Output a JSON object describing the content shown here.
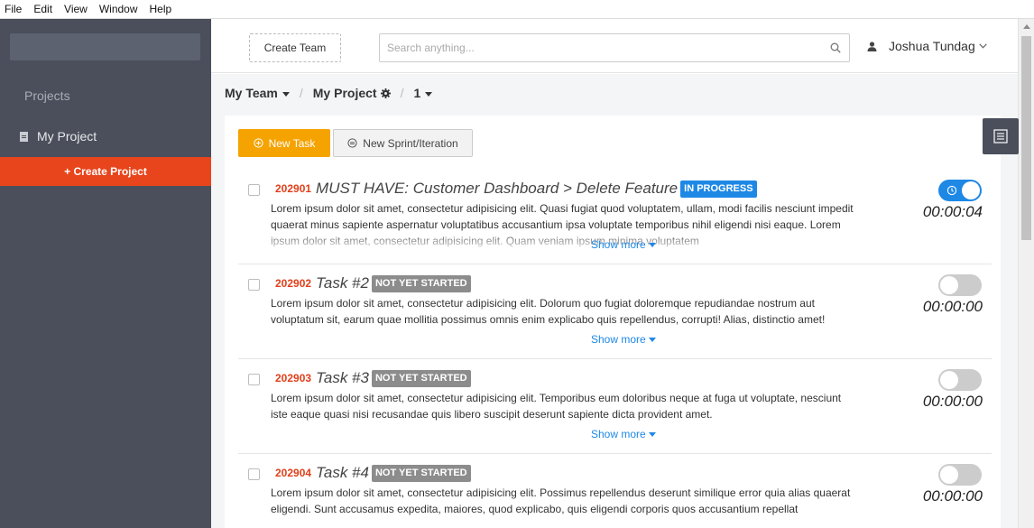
{
  "menu": [
    "File",
    "Edit",
    "View",
    "Window",
    "Help"
  ],
  "sidebar": {
    "section_label": "Projects",
    "project": "My Project",
    "create_project": "+ Create Project"
  },
  "topbar": {
    "create_team": "Create Team",
    "search_placeholder": "Search anything...",
    "user_name": "Joshua Tundag"
  },
  "breadcrumb": {
    "team": "My Team",
    "project": "My Project",
    "sprint": "1"
  },
  "actions": {
    "new_task": "New Task",
    "new_sprint": "New Sprint/Iteration"
  },
  "show_more": "Show more",
  "tasks": [
    {
      "id": "202901",
      "name": "MUST HAVE: Customer Dashboard > Delete Feature",
      "status": "IN PROGRESS",
      "desc": "Lorem ipsum dolor sit amet, consectetur adipisicing elit. Quasi fugiat quod voluptatem, ullam, modi facilis nesciunt impedit quaerat minus sapiente aspernatur voluptatibus accusantium ipsa voluptate temporibus nihil eligendi nisi eaque. Lorem ipsum dolor sit amet, consectetur adipisicing elit. Quam veniam ipsum minima voluptatem",
      "timer": "00:00:04",
      "running": true
    },
    {
      "id": "202902",
      "name": "Task #2",
      "status": "NOT YET STARTED",
      "desc": "Lorem ipsum dolor sit amet, consectetur adipisicing elit. Dolorum quo fugiat doloremque repudiandae nostrum aut voluptatum sit, earum quae mollitia possimus omnis enim explicabo quis repellendus, corrupti! Alias, distinctio amet!",
      "timer": "00:00:00",
      "running": false
    },
    {
      "id": "202903",
      "name": "Task #3",
      "status": "NOT YET STARTED",
      "desc": "Lorem ipsum dolor sit amet, consectetur adipisicing elit. Temporibus eum doloribus neque at fuga ut voluptate, nesciunt iste eaque quasi nisi recusandae quis libero suscipit deserunt sapiente dicta provident amet.",
      "timer": "00:00:00",
      "running": false
    },
    {
      "id": "202904",
      "name": "Task #4",
      "status": "NOT YET STARTED",
      "desc": "Lorem ipsum dolor sit amet, consectetur adipisicing elit. Possimus repellendus deserunt similique error quia alias quaerat eligendi. Sunt accusamus expedita, maiores, quod explicabo, quis eligendi corporis quos accusantium repellat",
      "timer": "00:00:00",
      "running": false
    }
  ]
}
